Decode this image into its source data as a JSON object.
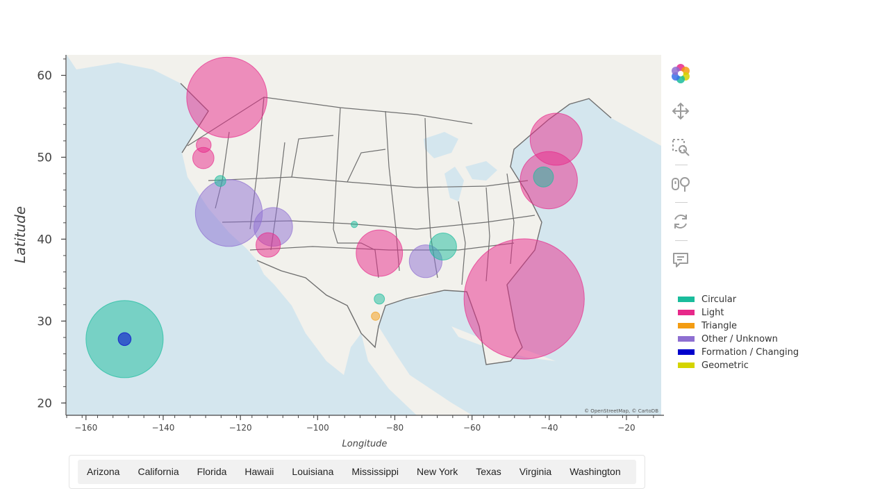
{
  "chart_data": {
    "type": "scatter",
    "title": "",
    "xlabel": "Longitude",
    "ylabel": "Latitude",
    "xlim": [
      -165,
      -11
    ],
    "ylim": [
      18.5,
      62.5
    ],
    "x_ticks": [
      -160,
      -140,
      -120,
      -100,
      -80,
      -60,
      -40,
      -20
    ],
    "y_ticks": [
      20,
      30,
      40,
      50,
      60
    ],
    "tick_labels_x": [
      "−160",
      "−140",
      "−120",
      "−100",
      "−80",
      "−60",
      "−40",
      "−20"
    ],
    "tick_labels_y": [
      "20",
      "30",
      "40",
      "50",
      "60"
    ],
    "grid": false,
    "legend_position": "right",
    "series": [
      {
        "name": "Circular",
        "color": "#1abc9c"
      },
      {
        "name": "Light",
        "color": "#e7298a"
      },
      {
        "name": "Triangle",
        "color": "#f39c12"
      },
      {
        "name": "Other / Unknown",
        "color": "#8e6fd1"
      },
      {
        "name": "Formation / Changing",
        "color": "#0000cc"
      },
      {
        "name": "Geometric",
        "color": "#d4d400"
      }
    ],
    "bubbles": [
      {
        "state": "Washington",
        "lon": -123.5,
        "lat": 57.3,
        "radius": 12.5,
        "series": "Light"
      },
      {
        "state": "California",
        "lon": -123,
        "lat": 43.2,
        "radius": 10.4,
        "series": "Other / Unknown"
      },
      {
        "state": "Arizona",
        "lon": -111.5,
        "lat": 41.5,
        "radius": 6.0,
        "series": "Other / Unknown"
      },
      {
        "state": "Arizona",
        "lon": -112.8,
        "lat": 39.3,
        "radius": 3.8,
        "series": "Light"
      },
      {
        "state": "California",
        "lon": -129.6,
        "lat": 49.9,
        "radius": 3.3,
        "series": "Light"
      },
      {
        "state": "California",
        "lon": -129.5,
        "lat": 51.5,
        "radius": 2.3,
        "series": "Light"
      },
      {
        "state": "Hawaii",
        "lon": -150,
        "lat": 27.8,
        "radius": 12.0,
        "series": "Circular"
      },
      {
        "state": "Hawaii",
        "lon": -150,
        "lat": 27.8,
        "radius": 2.0,
        "series": "Formation / Changing"
      },
      {
        "state": "Texas",
        "lon": -84,
        "lat": 38.3,
        "radius": 7.2,
        "series": "Light"
      },
      {
        "state": "Louisiana",
        "lon": -72,
        "lat": 37.3,
        "radius": 5.1,
        "series": "Other / Unknown"
      },
      {
        "state": "Mississippi",
        "lon": -67.5,
        "lat": 39.1,
        "radius": 4.2,
        "series": "Circular"
      },
      {
        "state": "Florida",
        "lon": -46.5,
        "lat": 32.7,
        "radius": 18.7,
        "series": "Light"
      },
      {
        "state": "Virginia",
        "lon": -40.1,
        "lat": 47.2,
        "radius": 8.9,
        "series": "Light"
      },
      {
        "state": "Virginia",
        "lon": -41.5,
        "lat": 47.6,
        "radius": 3.1,
        "series": "Circular"
      },
      {
        "state": "New York",
        "lon": -38.2,
        "lat": 52.2,
        "radius": 8.1,
        "series": "Light"
      },
      {
        "state": "Texas",
        "lon": -84,
        "lat": 32.7,
        "radius": 1.6,
        "series": "Circular"
      },
      {
        "state": "Texas",
        "lon": -90.5,
        "lat": 41.8,
        "radius": 1.0,
        "series": "Circular"
      },
      {
        "state": "California",
        "lon": -125.2,
        "lat": 47.1,
        "radius": 1.7,
        "series": "Circular"
      },
      {
        "state": "Texas",
        "lon": -85,
        "lat": 30.6,
        "radius": 1.3,
        "series": "Triangle"
      }
    ]
  },
  "tabs": [
    "Arizona",
    "California",
    "Florida",
    "Hawaii",
    "Louisiana",
    "Mississippi",
    "New York",
    "Texas",
    "Virginia",
    "Washington"
  ],
  "toolbar": {
    "tools": [
      "bokeh-logo-icon",
      "pan-icon",
      "box-zoom-icon",
      "wheel-zoom-icon",
      "reset-icon",
      "hover-icon"
    ]
  },
  "map_attribution": "© OpenStreetMap, © CartoDB"
}
